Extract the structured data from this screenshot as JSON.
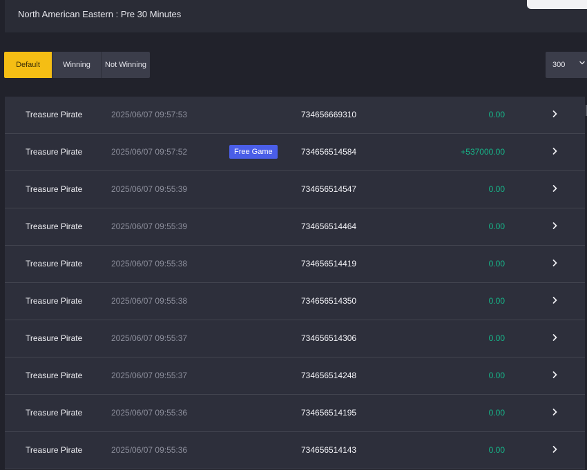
{
  "header": {
    "title": "North American Eastern : Pre 30 Minutes"
  },
  "filters": {
    "tabs": [
      "Default",
      "Winning",
      "Not Winning"
    ],
    "active": "Default"
  },
  "page_size": {
    "value": "300"
  },
  "icons": {
    "row_action": "chevron-right-icon",
    "select": "chevron-down-icon"
  },
  "colors": {
    "accent": "#f5be14",
    "win": "#16b88a",
    "badge": "#4a5ee8",
    "background": "#21222b"
  },
  "records": [
    {
      "game": "Treasure Pirate",
      "time": "2025/06/07 09:57:53",
      "badge": "",
      "id": "734656669310",
      "amount": "0.00"
    },
    {
      "game": "Treasure Pirate",
      "time": "2025/06/07 09:57:52",
      "badge": "Free Game",
      "id": "734656514584",
      "amount": "+537000.00"
    },
    {
      "game": "Treasure Pirate",
      "time": "2025/06/07 09:55:39",
      "badge": "",
      "id": "734656514547",
      "amount": "0.00"
    },
    {
      "game": "Treasure Pirate",
      "time": "2025/06/07 09:55:39",
      "badge": "",
      "id": "734656514464",
      "amount": "0.00"
    },
    {
      "game": "Treasure Pirate",
      "time": "2025/06/07 09:55:38",
      "badge": "",
      "id": "734656514419",
      "amount": "0.00"
    },
    {
      "game": "Treasure Pirate",
      "time": "2025/06/07 09:55:38",
      "badge": "",
      "id": "734656514350",
      "amount": "0.00"
    },
    {
      "game": "Treasure Pirate",
      "time": "2025/06/07 09:55:37",
      "badge": "",
      "id": "734656514306",
      "amount": "0.00"
    },
    {
      "game": "Treasure Pirate",
      "time": "2025/06/07 09:55:37",
      "badge": "",
      "id": "734656514248",
      "amount": "0.00"
    },
    {
      "game": "Treasure Pirate",
      "time": "2025/06/07 09:55:36",
      "badge": "",
      "id": "734656514195",
      "amount": "0.00"
    },
    {
      "game": "Treasure Pirate",
      "time": "2025/06/07 09:55:36",
      "badge": "",
      "id": "734656514143",
      "amount": "0.00"
    }
  ]
}
